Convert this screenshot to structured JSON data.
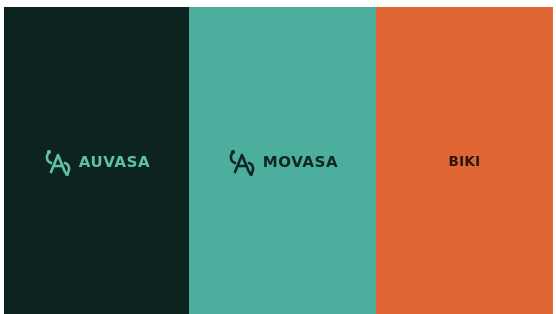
{
  "colors": {
    "dark": "#0c2320",
    "teal": "#4cae9d",
    "orange": "#e06633",
    "mint": "#5fc1a9",
    "ink": "#0e2622"
  },
  "panels": [
    {
      "brand": "AUVASA",
      "icon": "auvasa-logo-mark-icon",
      "bg": "#0c2320",
      "fg": "#5fc1a9"
    },
    {
      "brand": "MOVASA",
      "icon": "movasa-logo-mark-icon",
      "bg": "#4cae9d",
      "fg": "#0e2622"
    },
    {
      "brand": "BIKI",
      "bg": "#e06633",
      "fg": "#2a1610"
    }
  ]
}
